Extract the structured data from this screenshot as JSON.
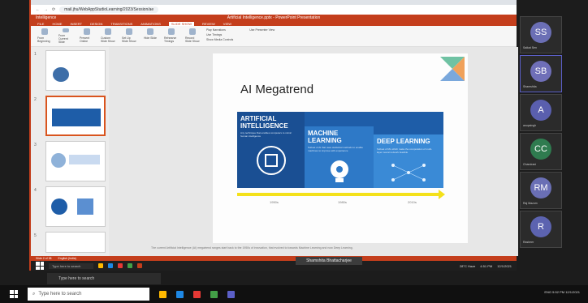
{
  "browser": {
    "url": "mail.jhu/WebAppStudioLearning/2023/Session/ae",
    "title_bar": "Intelligence",
    "doc_title": "Artificial Intelligence.pptx - PowerPoint Presentation",
    "ribbon_button": "Back",
    "tabs": [
      "FILE",
      "HOME",
      "INSERT",
      "DESIGN",
      "TRANSITIONS",
      "ANIMATIONS",
      "SLIDE SHOW",
      "REVIEW",
      "VIEW"
    ]
  },
  "ribbon": {
    "buttons": [
      "From Beginning",
      "From Current Slide",
      "Present Online",
      "Custom Slide Show",
      "Set Up Slide Show",
      "Hide Slide",
      "Rehearse Timings",
      "Record Slide Show"
    ],
    "checkbox_play_narrations": "Play Narrations",
    "checkbox_use_timings": "Use Timings",
    "checkbox_show_media": "Show Media Controls",
    "checkbox_presenter": "Use Presenter View"
  },
  "slide": {
    "title": "AI Megatrend",
    "ai_heading": [
      "ARTIFICIAL",
      "INTELLIGENCE"
    ],
    "ai_text": "Any technique that enables computers to mimic human intelligence",
    "ml_heading": [
      "MACHINE",
      "LEARNING"
    ],
    "ml_text": "Subset of AI that uses statistical methods to enable machines to improve with experience",
    "dl_heading": [
      "DEEP LEARNING"
    ],
    "dl_text": "Subset of ML which make the computation of multi-layer neural network feasible",
    "years": [
      "1950s",
      "1980s",
      "2010s"
    ],
    "notes": "The current Artificial Intelligence (AI) megatrend ranges start back to the 1950s of innovation, that evolved to towards Machine Learning and now Deep Learning."
  },
  "thumbnails": [
    {
      "num": "1"
    },
    {
      "num": "2"
    },
    {
      "num": "3"
    },
    {
      "num": "4"
    },
    {
      "num": "5"
    }
  ],
  "statusbar": {
    "left": "Slide 2 of 38",
    "lang": "English (India)"
  },
  "presenter_chip": "Shamshita Bhattacharjee",
  "taskbar_inner": {
    "search": "Type here to search",
    "time": "4:51 PM",
    "date": "12/1/2021",
    "weather": "28°C Haze"
  },
  "participants": [
    {
      "initials": "SS",
      "name": "Saikat Sen",
      "color": "#6b6fb5"
    },
    {
      "initials": "SB",
      "name": "Shamshita",
      "color": "#6f6fb8"
    },
    {
      "initials": "A",
      "name": "anupsingh",
      "color": "#5a5fae"
    },
    {
      "initials": "CC",
      "name": "Chandrani",
      "color": "#2f7b4f"
    },
    {
      "initials": "RM",
      "name": "Raj Mazum",
      "color": "#6a6fb5"
    },
    {
      "initials": "R",
      "name": "Rasheer",
      "color": "#5c63b0"
    }
  ],
  "taskbar_outer": {
    "search": "Type here to search",
    "time": "5:52 PM",
    "date": "12/1/2021",
    "lang": "ENG"
  },
  "second_search": "Type here to search",
  "colors": {
    "ppt_red": "#c43e1c",
    "ai_blue": "#1a4f93",
    "ml_blue": "#2e79c7",
    "dl_blue": "#3a8ad6",
    "timeline_yellow": "#f4e11a"
  }
}
